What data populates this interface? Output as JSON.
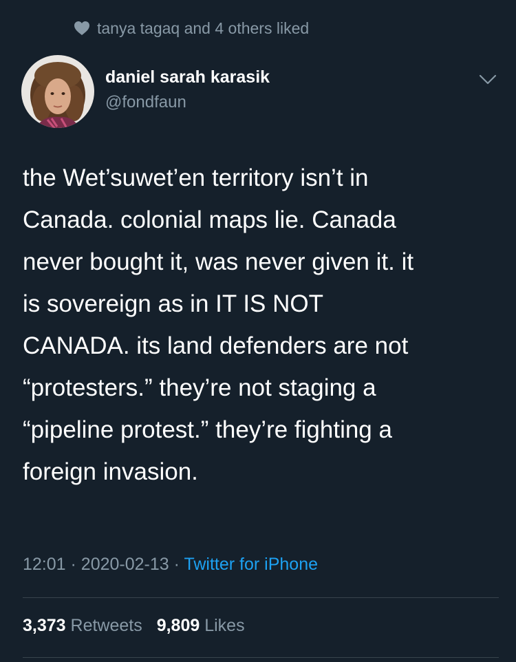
{
  "social_context": {
    "icon": "heart-icon",
    "text": "tanya tagaq and 4 others liked"
  },
  "author": {
    "display_name": "daniel sarah karasik",
    "handle": "@fondfaun"
  },
  "tweet": {
    "text": "the Wet’suwet’en territory isn’t in\nCanada. colonial maps lie. Canada\nnever bought it, was never given it. it\nis sovereign as in IT IS NOT\nCANADA. its land defenders are not\n“protesters.” they’re not staging a\n“pipeline protest.” they’re fighting a\nforeign invasion."
  },
  "meta": {
    "time": "12:01",
    "separator": "·",
    "date": "2020-02-13",
    "source": "Twitter for iPhone"
  },
  "stats": {
    "retweets_count": "3,373",
    "retweets_label": "Retweets",
    "likes_count": "9,809",
    "likes_label": "Likes"
  },
  "colors": {
    "background": "#15202b",
    "primary_text": "#ffffff",
    "secondary_text": "#8899a6",
    "link": "#1da1f2",
    "divider": "#38444d"
  }
}
